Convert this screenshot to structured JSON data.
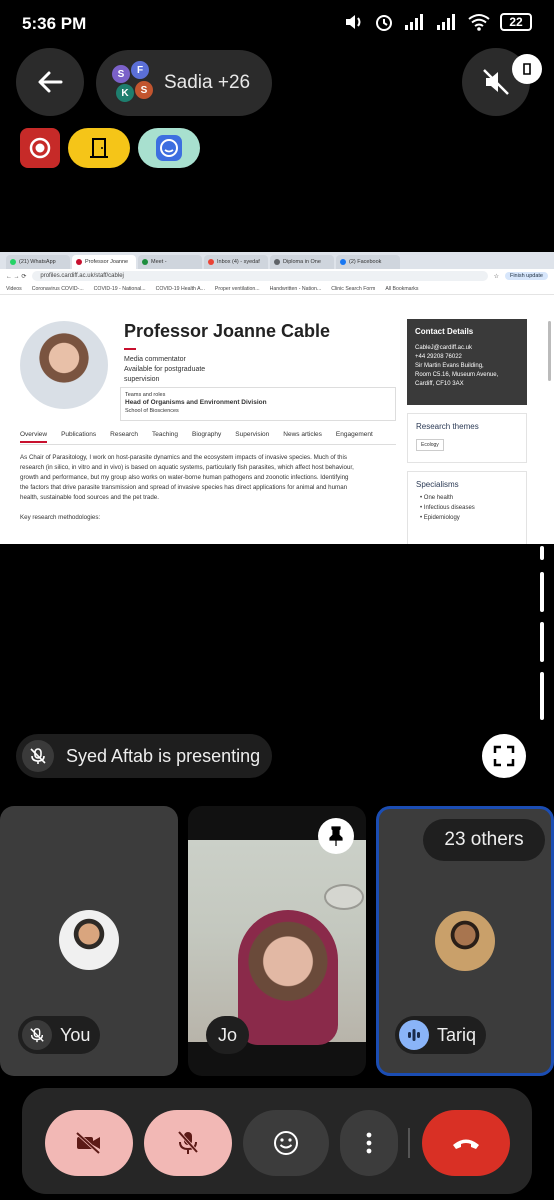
{
  "status_bar": {
    "time": "5:36 PM",
    "battery": "22"
  },
  "meeting": {
    "participants_label": "Sadia +26",
    "participant_initials": [
      "S",
      "F",
      "K",
      "S"
    ],
    "presenting_text": "Syed Aftab is presenting"
  },
  "shared_screen": {
    "tabs": [
      "(21) WhatsApp",
      "Professor Joanne",
      "Meet - ",
      "Inbox (4) - syedaf",
      "Diploma in One",
      "(2) Facebook"
    ],
    "url": "profiles.cardiff.ac.uk/staff/cablej",
    "finish_update": "Finish update",
    "bookmarks": [
      "Videos",
      "Coronavirus COVID-...",
      "COVID-19 - National...",
      "COVID-19 Health A...",
      "Proper ventilation...",
      "Handwritten - Nation...",
      "Clinic Search Form",
      "All Bookmarks"
    ],
    "profile": {
      "name": "Professor Joanne Cable",
      "meta": [
        "Media commentator",
        "Available for postgraduate",
        "supervision"
      ],
      "teams_heading": "Teams and roles",
      "role": "Head of Organisms and Environment Division",
      "school": "School of Biosciences",
      "nav": [
        "Overview",
        "Publications",
        "Research",
        "Teaching",
        "Biography",
        "Supervision",
        "News articles",
        "Engagement"
      ],
      "bio_lines": [
        "As Chair of Parasitology, I work on host-parasite dynamics and the ecosystem impacts of invasive species. Much of this",
        "research (in silico, in vitro and in vivo) is based on aquatic systems, particularly fish parasites, which affect host behaviour,",
        "growth and performance, but my group also works on water-borne human pathogens and zoonotic infections. Identifying",
        "the factors that drive parasite transmission and spread of invasive species has direct applications for animal and human",
        "health, sustainable food sources and the pet trade."
      ],
      "methodologies": "Key research methodologies:",
      "contact_heading": "Contact Details",
      "contact_lines": [
        "CableJ@cardiff.ac.uk",
        "+44 29208 76022",
        "Sir Martin Evans Building,",
        "Room C5.16, Museum Avenue,",
        "Cardiff, CF10 3AX"
      ],
      "research_themes_heading": "Research themes",
      "research_theme": "Ecology",
      "specialisms_heading": "Specialisms",
      "specialisms": [
        "One health",
        "Infectious diseases",
        "Epidemiology"
      ]
    }
  },
  "tiles": {
    "you": "You",
    "jo": "Jo",
    "tariq": "Tariq",
    "others": "23 others"
  },
  "colors": {
    "end_call": "#d93025",
    "muted_control": "#f2b8b5",
    "tile_highlight": "#1b4db3",
    "cardiff_red": "#c8102e"
  }
}
